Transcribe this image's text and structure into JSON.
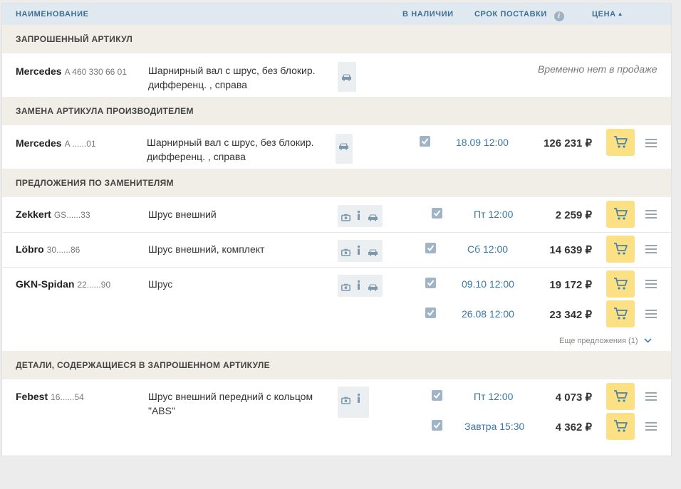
{
  "header": {
    "name": "НАИМЕНОВАНИЕ",
    "stock": "В НАЛИЧИИ",
    "delivery": "СРОК ПОСТАВКИ",
    "price": "ЦЕНА",
    "info_glyph": "i",
    "sort_glyph": "▲"
  },
  "sections": {
    "requested": "ЗАПРОШЕННЫЙ АРТИКУЛ",
    "replacement": "ЗАМЕНА АРТИКУЛА ПРОИЗВОДИТЕЛЕМ",
    "substitutes": "ПРЕДЛОЖЕНИЯ ПО ЗАМЕНИТЕЛЯМ",
    "contained": "ДЕТАЛИ, СОДЕРЖАЩИЕСЯ В ЗАПРОШЕННОМ АРТИКУЛЕ"
  },
  "rows": [
    {
      "brand": "Mercedes",
      "article": "A 460 330 66 01",
      "desc_lines": [
        "Шарнирный вал с шрус, без блокир.",
        "дифференц. , справа"
      ],
      "status": "Временно нет в продаже"
    },
    {
      "brand": "Mercedes",
      "article": "A ......01",
      "desc_lines": [
        "Шарнирный вал с шрус, без блокир.",
        "дифференц. , справа"
      ],
      "offers": [
        {
          "in_stock": true,
          "delivery": "18.09 12:00",
          "price": "126 231 ₽"
        }
      ]
    },
    {
      "brand": "Zekkert",
      "article": "GS......33",
      "desc_lines": [
        "Шрус внешний"
      ],
      "offers": [
        {
          "in_stock": true,
          "delivery": "Пт 12:00",
          "price": "2 259 ₽"
        }
      ]
    },
    {
      "brand": "Löbro",
      "article": "30......86",
      "desc_lines": [
        "Шрус внешний, комплект"
      ],
      "offers": [
        {
          "in_stock": true,
          "delivery": "Сб 12:00",
          "price": "14 639 ₽"
        }
      ]
    },
    {
      "brand": "GKN-Spidan",
      "article": "22......90",
      "desc_lines": [
        "Шрус"
      ],
      "offers": [
        {
          "in_stock": true,
          "delivery": "09.10 12:00",
          "price": "19 172 ₽"
        },
        {
          "in_stock": true,
          "delivery": "26.08 12:00",
          "price": "23 342 ₽"
        }
      ],
      "more": "Еще предложения (1)"
    },
    {
      "brand": "Febest",
      "article": "16......54",
      "desc_lines": [
        "Шрус внешний передний с кольцом",
        "\"ABS\""
      ],
      "offers": [
        {
          "in_stock": true,
          "delivery": "Пт 12:00",
          "price": "4 073 ₽"
        },
        {
          "in_stock": true,
          "delivery": "Завтра 15:30",
          "price": "4 362 ₽"
        }
      ]
    }
  ],
  "icons": {
    "photo": "camera-icon",
    "info": "info-icon",
    "car": "car-icon",
    "cart": "cart-icon",
    "menu": "menu-icon",
    "chevron": "chevron-down-icon"
  },
  "colors": {
    "header_bg": "#dfe9ef",
    "header_text": "#3d6f95",
    "section_bg": "#f1eee7",
    "cart_bg": "#fbe183",
    "date_text": "#3a78a6",
    "checkbox": "#9fb5c7"
  }
}
